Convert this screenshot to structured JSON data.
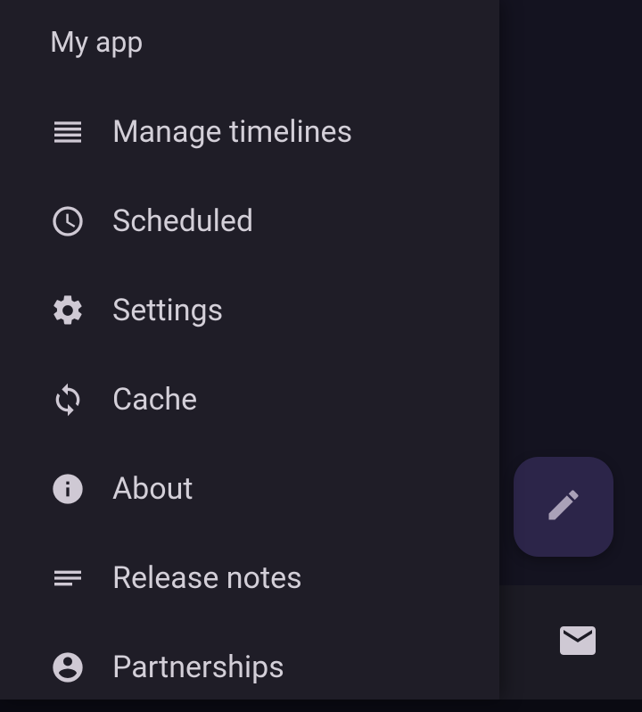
{
  "drawer": {
    "title": "My app",
    "items": [
      {
        "label": "Manage timelines",
        "icon": "timelines-icon"
      },
      {
        "label": "Scheduled",
        "icon": "clock-icon"
      },
      {
        "label": "Settings",
        "icon": "gear-icon"
      },
      {
        "label": "Cache",
        "icon": "sync-icon"
      },
      {
        "label": "About",
        "icon": "info-icon"
      },
      {
        "label": "Release notes",
        "icon": "notes-icon"
      },
      {
        "label": "Partnerships",
        "icon": "person-icon"
      }
    ]
  },
  "fab": {
    "icon": "pencil-icon"
  },
  "bottom_nav": {
    "icon": "mail-icon"
  }
}
